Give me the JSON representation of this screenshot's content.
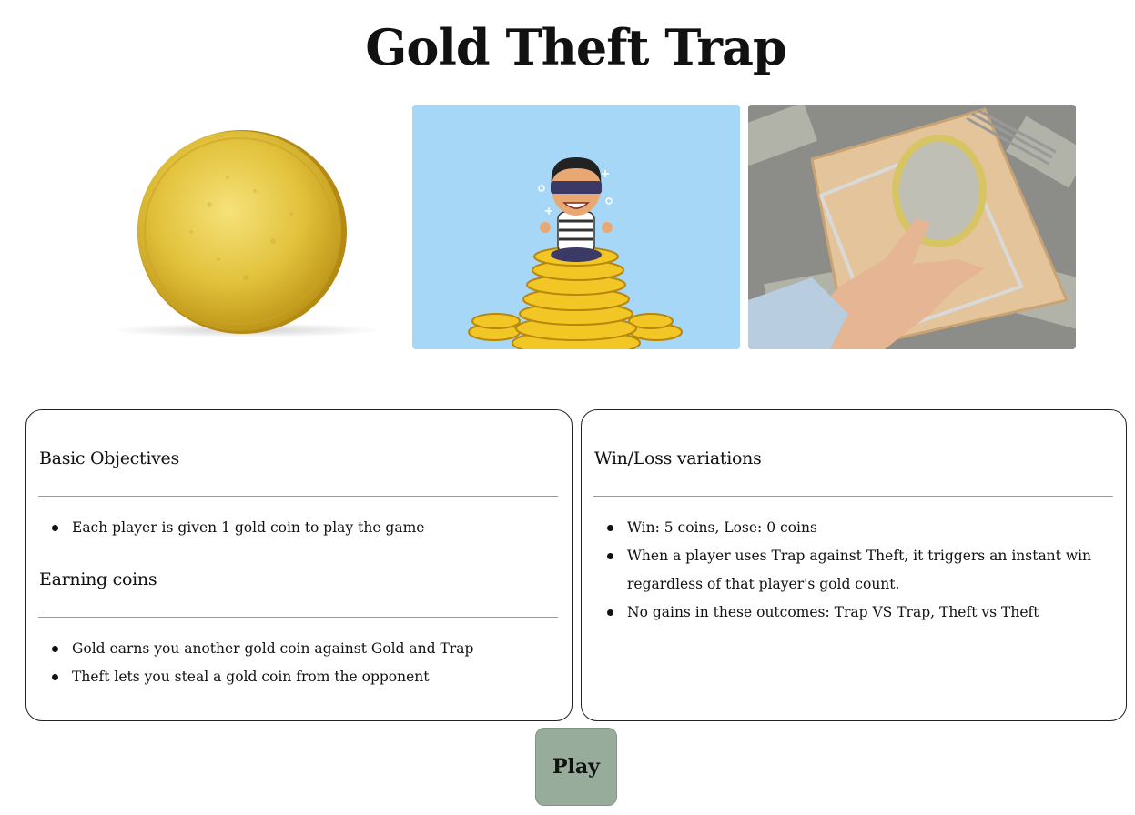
{
  "title": "Gold Theft Trap",
  "images": [
    {
      "name": "gold-coin-image"
    },
    {
      "name": "thief-on-coins-image"
    },
    {
      "name": "coin-mousetrap-image"
    }
  ],
  "panels": {
    "left": {
      "sections": [
        {
          "heading": "Basic Objectives",
          "items": [
            "Each player is given 1 gold coin to play the game"
          ]
        },
        {
          "heading": "Earning coins",
          "items": [
            "Gold earns you another gold coin against Gold and Trap",
            "Theft lets you steal a gold coin from the opponent"
          ]
        }
      ]
    },
    "right": {
      "sections": [
        {
          "heading": "Win/Loss variations",
          "items": [
            "Win: 5 coins, Lose: 0 coins",
            "When a player uses Trap against Theft, it triggers an instant win regardless of that player's gold count.",
            "No gains in these outcomes: Trap VS Trap, Theft vs Theft"
          ]
        }
      ]
    }
  },
  "play_button": {
    "label": "Play"
  },
  "colors": {
    "play_button_bg": "#97ac9b",
    "thief_bg": "#a7d7f7",
    "gold": "#e2b928"
  }
}
